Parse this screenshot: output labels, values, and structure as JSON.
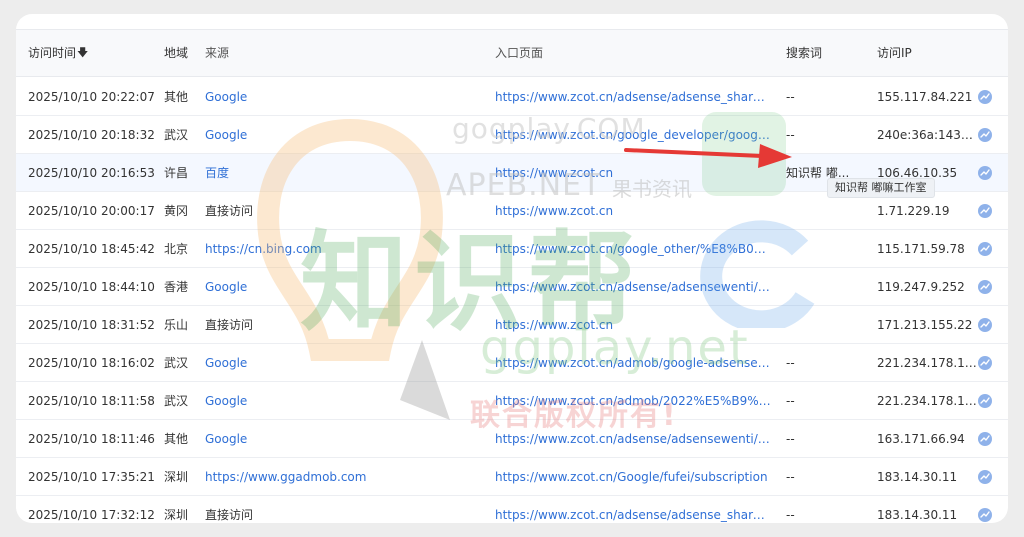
{
  "table": {
    "headers": {
      "time": "访问时间",
      "region": "地域",
      "source": "来源",
      "entry": "入口页面",
      "keyword": "搜索词",
      "ip": "访问IP"
    },
    "rows": [
      {
        "time": "2025/10/10 20:22:07",
        "region": "其他",
        "source": "Google",
        "source_link": true,
        "entry": "https://www.zcot.cn/adsense/adsense_share/20...",
        "keyword": "--",
        "ip": "155.117.84.221"
      },
      {
        "time": "2025/10/10 20:18:32",
        "region": "武汉",
        "source": "Google",
        "source_link": true,
        "entry": "https://www.zcot.cn/google_developer/google-p...",
        "keyword": "--",
        "ip": "240e:36a:1437:..."
      },
      {
        "time": "2025/10/10 20:16:53",
        "region": "许昌",
        "source": "百度",
        "source_link": true,
        "entry": "https://www.zcot.cn",
        "keyword": "知识帮 嘟...",
        "ip": "106.46.10.35"
      },
      {
        "time": "2025/10/10 20:00:17",
        "region": "黄冈",
        "source": "直接访问",
        "source_link": false,
        "entry": "https://www.zcot.cn",
        "keyword": "",
        "ip": "1.71.229.19"
      },
      {
        "time": "2025/10/10 18:45:42",
        "region": "北京",
        "source": "https://cn.bing.com",
        "source_link": true,
        "entry": "https://www.zcot.cn/google_other/%E8%B0%B...",
        "keyword": "",
        "ip": "115.171.59.78"
      },
      {
        "time": "2025/10/10 18:44:10",
        "region": "香港",
        "source": "Google",
        "source_link": true,
        "entry": "https://www.zcot.cn/adsense/adsensewenti/%E...",
        "keyword": "",
        "ip": "119.247.9.252"
      },
      {
        "time": "2025/10/10 18:31:52",
        "region": "乐山",
        "source": "直接访问",
        "source_link": false,
        "entry": "https://www.zcot.cn",
        "keyword": "",
        "ip": "171.213.155.22"
      },
      {
        "time": "2025/10/10 18:16:02",
        "region": "武汉",
        "source": "Google",
        "source_link": true,
        "entry": "https://www.zcot.cn/admob/google-adsense-ad...",
        "keyword": "--",
        "ip": "221.234.178.176"
      },
      {
        "time": "2025/10/10 18:11:58",
        "region": "武汉",
        "source": "Google",
        "source_link": true,
        "entry": "https://www.zcot.cn/admob/2022%E5%B9%B4...",
        "keyword": "--",
        "ip": "221.234.178.176"
      },
      {
        "time": "2025/10/10 18:11:46",
        "region": "其他",
        "source": "Google",
        "source_link": true,
        "entry": "https://www.zcot.cn/adsense/adsensewenti/202...",
        "keyword": "--",
        "ip": "163.171.66.94"
      },
      {
        "time": "2025/10/10 17:35:21",
        "region": "深圳",
        "source": "https://www.ggadmob.com",
        "source_link": true,
        "entry": "https://www.zcot.cn/Google/fufei/subscription",
        "keyword": "--",
        "ip": "183.14.30.11"
      },
      {
        "time": "2025/10/10 17:32:12",
        "region": "深圳",
        "source": "直接访问",
        "source_link": false,
        "entry": "https://www.zcot.cn/adsense/adsense_share/%...",
        "keyword": "--",
        "ip": "183.14.30.11"
      }
    ]
  },
  "tooltip": {
    "text": "知识帮 嘟嘛工作室"
  },
  "watermark": {
    "gogplay": "gogplay.COM",
    "apeb": "APEB.NET",
    "guoshu": "果书资讯",
    "zhishibang": "知识帮",
    "ggplay": "ggplay.net",
    "lianhe": "联合版权所有!"
  },
  "icons": {
    "sort": "arrow-down-icon",
    "trend": "trend-chart-icon"
  },
  "colors": {
    "link": "#2f6fd6",
    "highlight_row": "#f4f8ff",
    "trend_icon": "#8fb2ea",
    "arrow": "#e53935"
  }
}
